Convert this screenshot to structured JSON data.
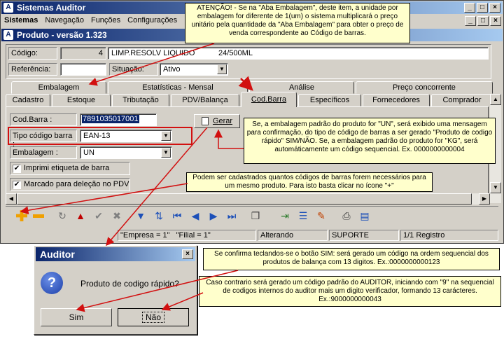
{
  "app": {
    "title": "Sistemas Auditor",
    "menu": [
      "Sistemas",
      "Navegação",
      "Funções",
      "Configurações"
    ]
  },
  "child": {
    "title": "Produto - versão 1.323"
  },
  "fields": {
    "codigo_label": "Código:",
    "codigo_value": "4",
    "descricao": "LIMP.RESOLV LIQUIDO           24/500ML",
    "referencia_label": "Referência:",
    "situacao_label": "Situação:",
    "situacao_value": "Ativo"
  },
  "tabs_row1": [
    "Embalagem",
    "Estatísticas - Mensal",
    "Análise",
    "Preço concorrente"
  ],
  "tabs_row2": [
    "Cadastro",
    "Estoque",
    "Tributação",
    "PDV/Balança",
    "Cod.Barra",
    "Específicos",
    "Fornecedores",
    "Comprador"
  ],
  "barcode": {
    "cod_label": "Cod.Barra :",
    "cod_value": "7891035017001",
    "tipo_label": "Tipo código barra :",
    "tipo_value": "EAN-13",
    "emb_label": "Embalagem :",
    "emb_value": "UN",
    "gerar_label": "Gerar",
    "chk1_label": "Imprimi etiqueta de barra",
    "chk2_label": "Marcado para deleção no PDV"
  },
  "status": {
    "empresa": "\"Empresa = 1\"   \"Filial = 1\"",
    "mode": "Alterando",
    "user": "SUPORTE",
    "records": "1/1 Registro"
  },
  "dialog": {
    "title": "Auditor",
    "message": "Produto de codigo rápido?",
    "yes": "Sim",
    "no": "Não"
  },
  "notes": {
    "n1": "ATENÇÃO! - Se na \"Aba Embalagem\", deste item, a unidade por embalagem for diferente de 1(um) o sistema multiplicará o preço unitário pela quantidade da \"Aba Embalagem\" para obter o preço de venda correspondente ao Código de barras.",
    "n2": "Se,  a embalagem padrão do produto for \"UN\",  será exibido uma mensagem para confirmação, do tipo de código de barras a ser gerado \"Produto de codigo rápido\" SIM/NÃO. Se,  a embalagem padrão do produto for \"KG\",  será automáticamente um código sequencial. Ex. 0000000000004",
    "n3": "Podem ser cadastrados quantos códigos de barras forem necessários para um mesmo produto. Para isto basta clicar no ícone \"+\"",
    "n4": "Se confirma teclandos-se o botão SIM: será gerado um código na ordem sequencial dos produtos de balança com 13 digitos. Ex.:0000000000123",
    "n5": "Caso contrario será gerado um código padrão do AUDITOR, iniciando com \"9\" na  sequencial de codigos internos do auditor mais um digito verificador, formando 13 carácteres. Ex.:9000000000043"
  }
}
